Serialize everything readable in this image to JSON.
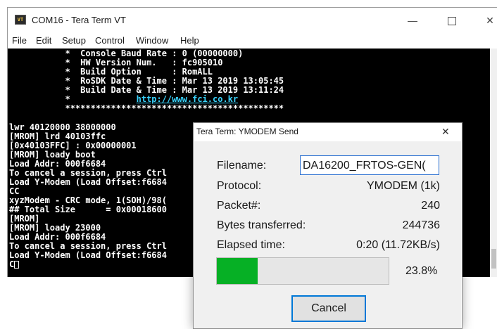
{
  "window": {
    "title": "COM16 - Tera Term VT",
    "icon_label": "VT",
    "minimize_glyph": "—",
    "close_glyph": "✕"
  },
  "menu": [
    "File",
    "Edit",
    "Setup",
    "Control",
    "Window",
    "Help"
  ],
  "terminal": {
    "lines": [
      "           *  Console Baud Rate : 0 (00000000)",
      "           *  HW Version Num.   : fc905010",
      "           *  Build Option      : RomALL",
      "           *  RoSDK Date & Time : Mar 13 2019 13:05:45",
      "           *  Build Date & Time : Mar 13 2019 13:11:24",
      "",
      "           *******************************************",
      "",
      "lwr 40120000 38000000",
      "[MROM] lrd 40103ffc",
      "[0x40103FFC] : 0x00000001",
      "[MROM] loady boot",
      "Load Addr: 000f6684",
      "To cancel a session, press Ctrl",
      "Load Y-Modem (Load Offset:f6684",
      "CC",
      "xyzModem - CRC mode, 1(SOH)/98(",
      "## Total Size      = 0x00018600",
      "[MROM]",
      "[MROM] loady 23000",
      "Load Addr: 000f6684",
      "To cancel a session, press Ctrl",
      "Load Y-Modem (Load Offset:f6684",
      "C"
    ],
    "link_prefix": "           *",
    "link_text": "http://www.fci.co.kr"
  },
  "dialog": {
    "title": "Tera Term: YMODEM Send",
    "close_glyph": "✕",
    "filename_label": "Filename:",
    "filename_value": "DA16200_FRTOS-GEN(",
    "protocol_label": "Protocol:",
    "protocol_value": "YMODEM (1k)",
    "packet_label": "Packet#:",
    "packet_value": "240",
    "bytes_label": "Bytes transferred:",
    "bytes_value": "244736",
    "elapsed_label": "Elapsed time:",
    "elapsed_value": "0:20 (11.72KB/s)",
    "progress_percent": 23.8,
    "progress_text": "23.8%",
    "cancel_label": "Cancel",
    "progress_color": "#06b025"
  }
}
